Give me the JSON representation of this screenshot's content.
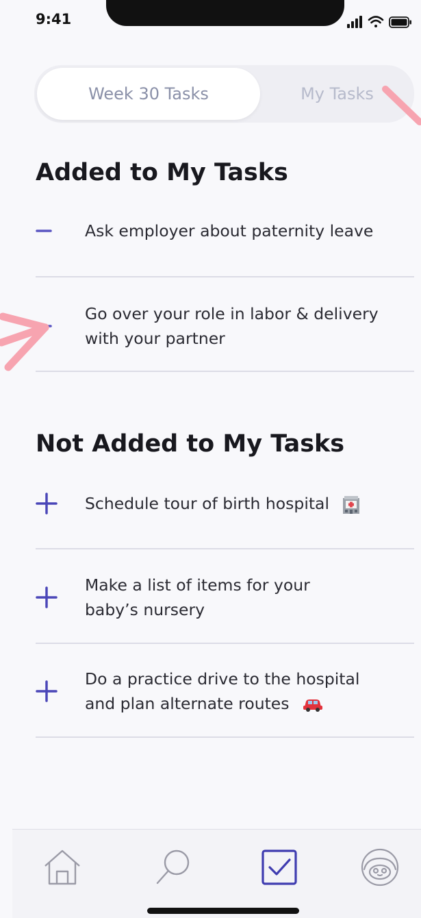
{
  "status_bar": {
    "time": "9:41"
  },
  "segmented_control": {
    "tabs": [
      {
        "label": "Week 30 Tasks",
        "selected": true
      },
      {
        "label": "My Tasks",
        "selected": false
      }
    ]
  },
  "added_section": {
    "title": "Added to My Tasks",
    "items": [
      {
        "text": "Ask employer about paternity leave",
        "action": "remove"
      },
      {
        "text": "Go over your role in labor & delivery with your partner",
        "action": "remove"
      }
    ]
  },
  "not_added_section": {
    "title": "Not Added to My Tasks",
    "items": [
      {
        "text": "Schedule tour of birth hospital",
        "emoji": "hospital",
        "action": "add"
      },
      {
        "text": "Make a list of items for your baby’s nursery",
        "action": "add"
      },
      {
        "text": "Do a practice drive to the hospital and plan alternate routes",
        "emoji": "car",
        "action": "add"
      }
    ]
  },
  "tab_bar": {
    "items": [
      {
        "icon": "home-icon",
        "active": false
      },
      {
        "icon": "search-icon",
        "active": false
      },
      {
        "icon": "tasks-checkbox-icon",
        "active": true
      },
      {
        "icon": "profile-avatar-icon",
        "active": false
      }
    ]
  },
  "colors": {
    "accent": "#4a46b8",
    "annotation": "#f7a4b0",
    "muted_text": "#9da2b8",
    "background": "#f8f8fb"
  }
}
